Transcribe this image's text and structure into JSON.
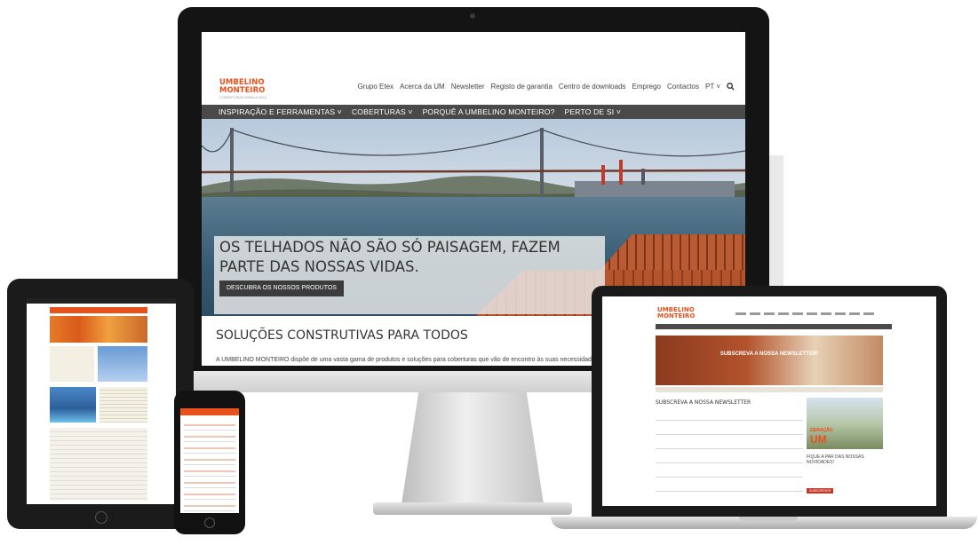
{
  "imac": {
    "logo_line1": "UMBELINO",
    "logo_line2": "MONTEIRO",
    "logo_tag": "COBERTURAS PARA A VIDA",
    "top_links": [
      "Grupo Etex",
      "Acerca da UM",
      "Newsletter",
      "Registo de garantia",
      "Centro de downloads",
      "Emprego",
      "Contactos",
      "PT ˅"
    ],
    "nav": [
      "INSPIRAÇÃO E FERRAMENTAS ˅",
      "COBERTURAS ˅",
      "PORQUÊ A UMBELINO MONTEIRO?",
      "PERTO DE SI ˅"
    ],
    "hero_title": "OS TELHADOS NÃO SÃO SÓ PAISAGEM, FAZEM PARTE DAS NOSSAS VIDAS.",
    "hero_button": "DESCUBRA OS NOSSOS PRODUTOS",
    "section_title": "SOLUÇÕES CONSTRUTIVAS PARA TODOS",
    "section_text": "A UMBELINO MONTEIRO dispõe de uma vasta gama de produtos e soluções para coberturas que vão de encontro às suas necessidades."
  },
  "laptop": {
    "logo_line1": "UMBELINO",
    "logo_line2": "MONTEIRO",
    "banner_title": "SUBSCREVA A NOSSA NEWSLETTER!",
    "form_title": "SUBSCREVA A NOSSA NEWSLETTER",
    "side_badge_top": "GERAÇÃO",
    "side_badge_main": "UM",
    "side_title": "FIQUE A PAR DAS NOSSAS NOVIDADES!",
    "submit_label": "SUBSCREVER"
  },
  "colors": {
    "brand": "#e8501c",
    "nav": "#4a4a4a"
  },
  "icons": {
    "search": "search-icon"
  }
}
